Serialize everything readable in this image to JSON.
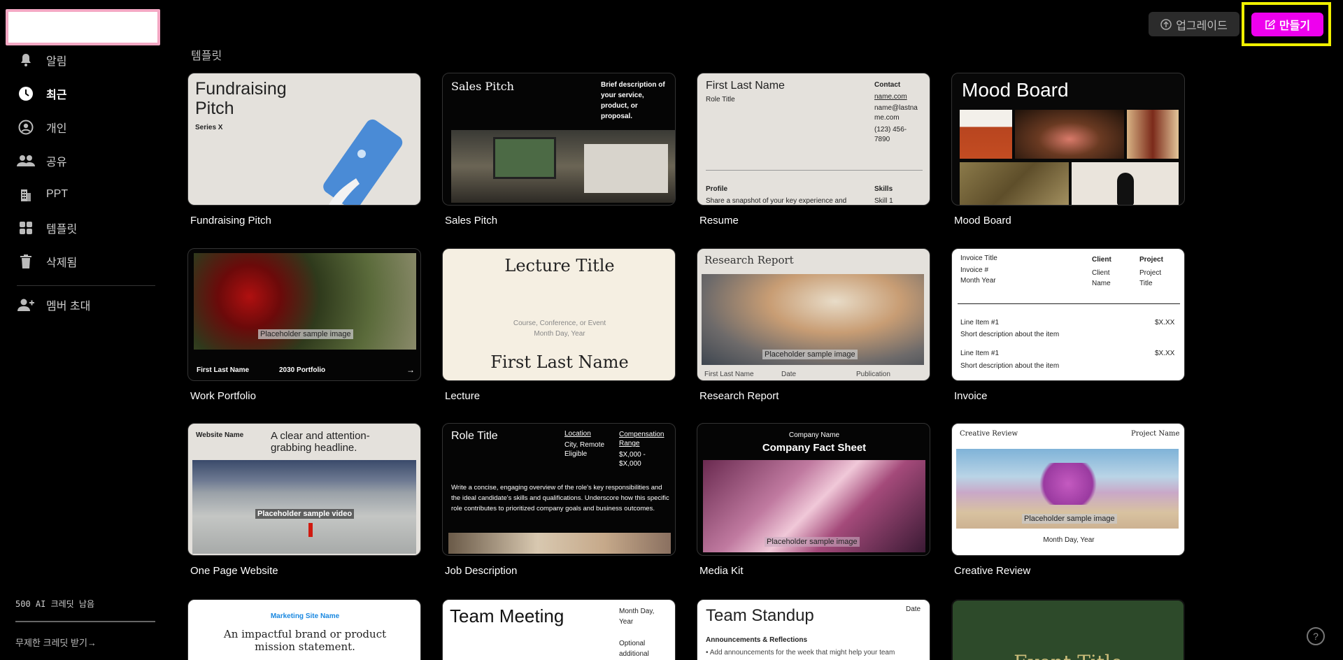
{
  "sidebar": {
    "items": [
      {
        "label": "알림",
        "icon": "bell-icon"
      },
      {
        "label": "최근",
        "icon": "clock-icon"
      },
      {
        "label": "개인",
        "icon": "person-icon"
      },
      {
        "label": "공유",
        "icon": "people-icon"
      },
      {
        "label": "PPT",
        "icon": "building-icon"
      },
      {
        "label": "템플릿",
        "icon": "grid-icon"
      },
      {
        "label": "삭제됨",
        "icon": "trash-icon"
      }
    ],
    "invite_label": "멤버 초대",
    "credits_text": "500 AI 크레딧 남음",
    "credits_link": "무제한 크레딧 받기→"
  },
  "header": {
    "upgrade_label": "업그레이드",
    "create_label": "만들기",
    "accent_color": "#ee00ee"
  },
  "section_title": "템플릿",
  "templates": [
    {
      "name": "Fundraising Pitch",
      "thumb": {
        "title": "Fundraising Pitch",
        "subtitle": "Series X"
      }
    },
    {
      "name": "Sales Pitch",
      "thumb": {
        "title": "Sales Pitch",
        "desc": "Brief description of your service, product, or proposal."
      }
    },
    {
      "name": "Resume",
      "thumb": {
        "name": "First Last Name",
        "role": "Role Title",
        "contact_h": "Contact",
        "contact": "name.com",
        "email": "name@lastname.com",
        "phone": "(123) 456-7890",
        "profile_h": "Profile",
        "profile": "Share a snapshot of your key experience and",
        "skills_h": "Skills",
        "skill": "Skill 1"
      }
    },
    {
      "name": "Mood Board",
      "thumb": {
        "title": "Mood Board"
      }
    },
    {
      "name": "Work Portfolio",
      "thumb": {
        "name": "First Last Name",
        "portfolio": "2030 Portfolio",
        "placeholder": "Placeholder sample image",
        "arrow": "→"
      }
    },
    {
      "name": "Lecture",
      "thumb": {
        "title": "Lecture Title",
        "sub": "Course, Conference, or Event",
        "date": "Month Day, Year",
        "name": "First Last Name"
      }
    },
    {
      "name": "Research Report",
      "thumb": {
        "title": "Research Report",
        "placeholder": "Placeholder sample image",
        "name": "First Last Name",
        "date": "Date",
        "pub": "Publication"
      }
    },
    {
      "name": "Invoice",
      "thumb": {
        "title": "Invoice Title",
        "num": "Invoice #",
        "my": "Month Year",
        "client_h": "Client",
        "client": "Client Name",
        "project_h": "Project",
        "project": "Project Title",
        "line1": "Line Item #1",
        "desc1": "Short description about the item",
        "price1": "$X.XX",
        "line2": "Line Item #1",
        "desc2": "Short description about the item",
        "price2": "$X.XX"
      }
    },
    {
      "name": "One Page Website",
      "thumb": {
        "site": "Website Name",
        "headline": "A clear and attention-grabbing headline.",
        "placeholder": "Placeholder sample video"
      }
    },
    {
      "name": "Job Description",
      "thumb": {
        "role": "Role Title",
        "loc_h": "Location",
        "loc": "City, Remote Eligible",
        "comp_h": "Compensation Range",
        "comp": "$X,000 - $X,000",
        "body": "Write a concise, engaging overview of the role's key responsibilities and the ideal candidate's skills and qualifications. Underscore how this specific role contributes to prioritized company goals and business outcomes."
      }
    },
    {
      "name": "Media Kit",
      "thumb": {
        "company": "Company Name",
        "title": "Company Fact Sheet",
        "placeholder": "Placeholder sample image"
      }
    },
    {
      "name": "Creative Review",
      "thumb": {
        "title": "Creative Review",
        "project": "Project Name",
        "placeholder": "Placeholder sample image",
        "date": "Month Day, Year"
      }
    },
    {
      "name": "",
      "thumb": {
        "site": "Marketing Site Name",
        "statement": "An impactful brand or product mission statement."
      }
    },
    {
      "name": "",
      "thumb": {
        "title": "Team Meeting",
        "date": "Month Day, Year",
        "opt": "Optional additional"
      }
    },
    {
      "name": "",
      "thumb": {
        "title": "Team Standup",
        "date": "Date",
        "sec": "Announcements & Reflections",
        "bullet": "• Add announcements for the week that might help your team"
      }
    },
    {
      "name": "",
      "thumb": {
        "title": "Event Title"
      }
    }
  ]
}
